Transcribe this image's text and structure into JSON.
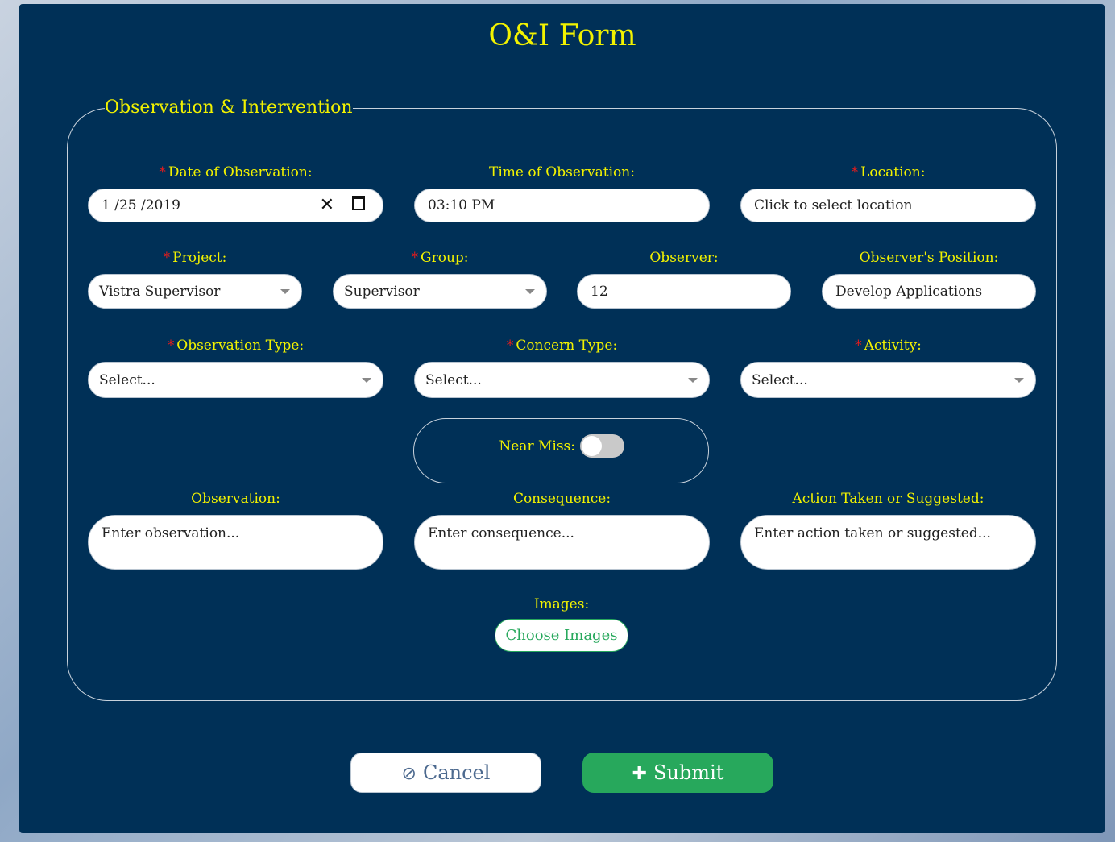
{
  "form": {
    "title": "O&I Form",
    "legend": "Observation & Intervention"
  },
  "fields": {
    "date": {
      "label": "Date of Observation:",
      "required": "*",
      "value": "1 /25 /2019"
    },
    "time": {
      "label": "Time of Observation:",
      "value": "03:10 PM"
    },
    "location": {
      "label": "Location:",
      "required": "*",
      "placeholder": "Click to select location"
    },
    "project": {
      "label": "Project:",
      "required": "*",
      "value": "Vistra Supervisor"
    },
    "group": {
      "label": "Group:",
      "required": "*",
      "value": "Supervisor"
    },
    "observer": {
      "label": "Observer:",
      "value": "12"
    },
    "observer_position": {
      "label": "Observer's Position:",
      "value": "Develop Applications"
    },
    "observation_type": {
      "label": "Observation Type:",
      "required": "*",
      "placeholder": "Select..."
    },
    "concern_type": {
      "label": "Concern Type:",
      "required": "*",
      "placeholder": "Select..."
    },
    "activity": {
      "label": "Activity:",
      "required": "*",
      "placeholder": "Select..."
    },
    "near_miss": {
      "label": "Near Miss:",
      "checked": false
    },
    "observation": {
      "label": "Observation:",
      "placeholder": "Enter observation..."
    },
    "consequence": {
      "label": "Consequence:",
      "placeholder": "Enter consequence..."
    },
    "action": {
      "label": "Action Taken or Suggested:",
      "placeholder": "Enter action taken or suggested..."
    },
    "images": {
      "label": "Images:",
      "button": "Choose Images"
    }
  },
  "buttons": {
    "cancel": "Cancel",
    "submit": "Submit"
  },
  "colors": {
    "panel_bg": "#003057",
    "label": "#f2f200",
    "required": "#e81b1b",
    "submit": "#27a85c"
  },
  "icons": {
    "clear": "close-icon",
    "calendar": "calendar-icon",
    "cancel": "ban-icon",
    "submit": "plus-icon"
  }
}
